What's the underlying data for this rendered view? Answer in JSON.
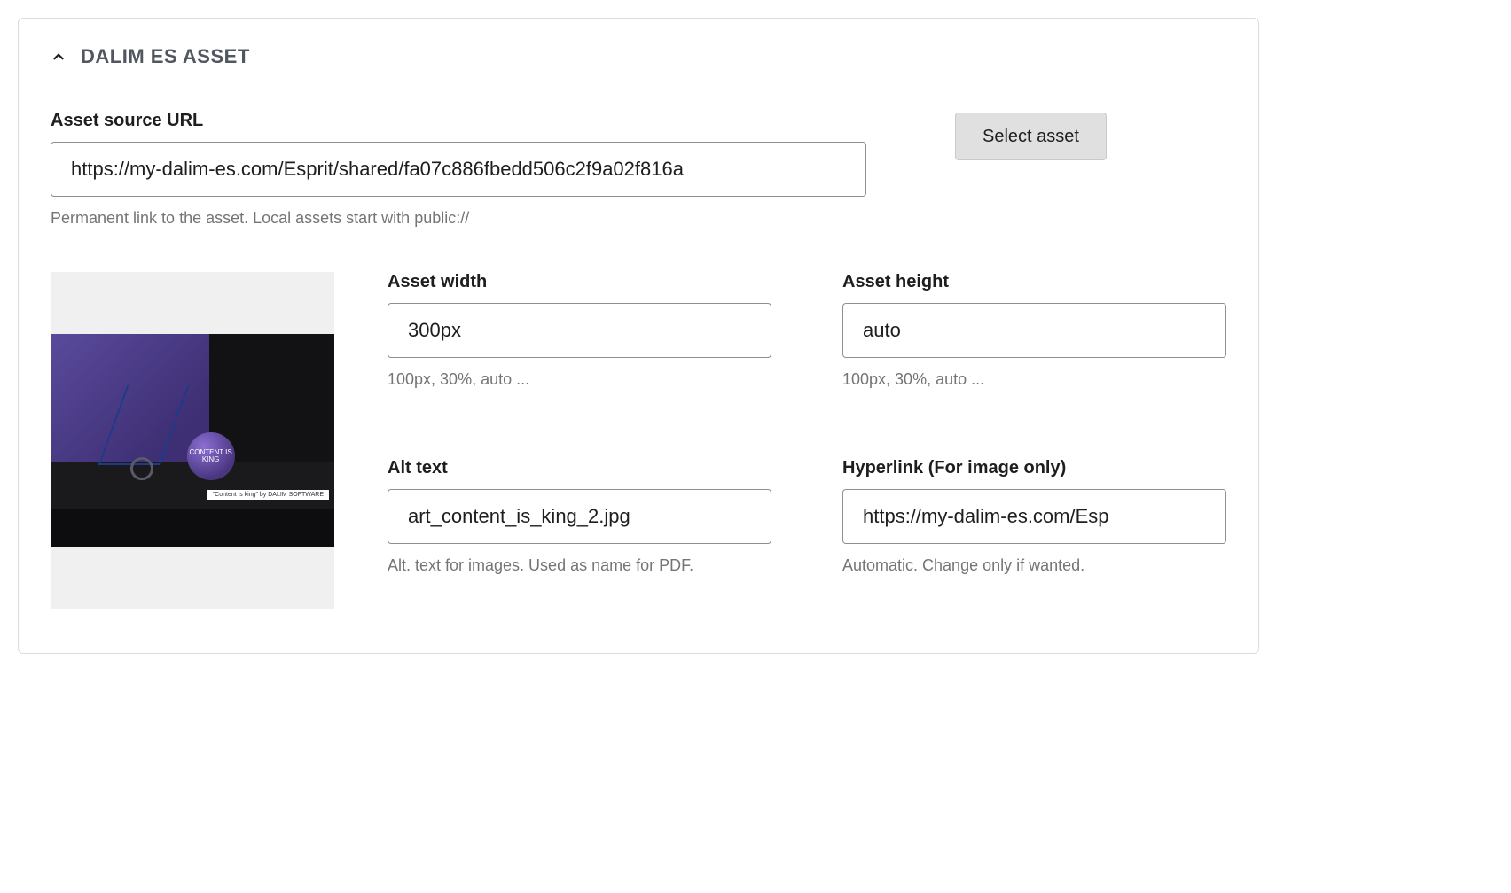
{
  "panel": {
    "title": "DALIM ES ASSET"
  },
  "source_url": {
    "label": "Asset source URL",
    "value": "https://my-dalim-es.com/Esprit/shared/fa07c886fbedd506c2f9a02f816a",
    "help": "Permanent link to the asset. Local assets start with public://"
  },
  "select_button": {
    "label": "Select asset"
  },
  "thumbnail": {
    "caption": "\"Content is king\" by DALIM SOFTWARE",
    "ball_text": "CONTENT IS\nKING"
  },
  "width": {
    "label": "Asset width",
    "value": "300px",
    "help": "100px, 30%, auto ..."
  },
  "height": {
    "label": "Asset height",
    "value": "auto",
    "help": "100px, 30%, auto ..."
  },
  "alt": {
    "label": "Alt text",
    "value": "art_content_is_king_2.jpg",
    "help": "Alt. text for images. Used as name for PDF."
  },
  "hyperlink": {
    "label": "Hyperlink (For image only)",
    "value": "https://my-dalim-es.com/Esp",
    "help": "Automatic. Change only if wanted."
  }
}
